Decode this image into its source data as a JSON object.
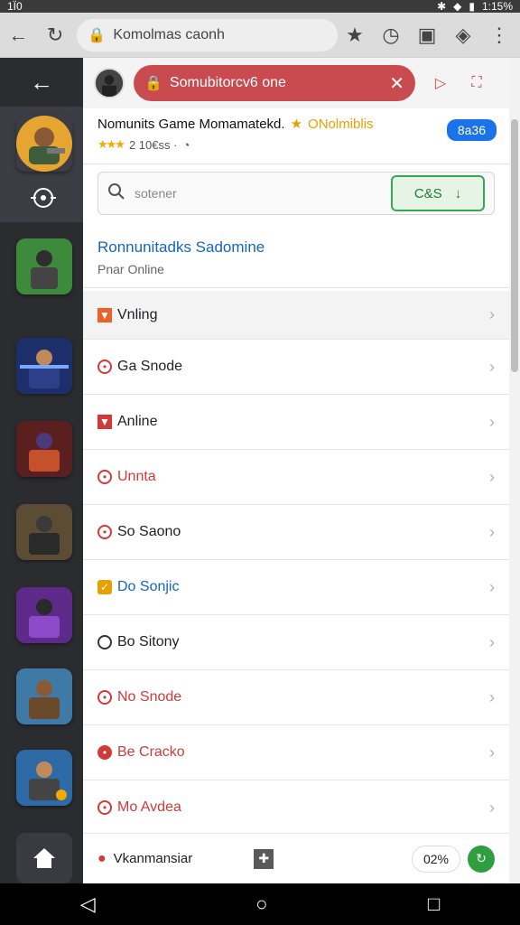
{
  "status": {
    "left": "1Ï0",
    "right": "1:15%"
  },
  "browser": {
    "url_text": "Komolmas caonh"
  },
  "tab": {
    "title": "Somubitorcv6 one"
  },
  "app": {
    "title": "Nomunits Game Momamatekd.",
    "developer": "ONolmiblis",
    "rating_text": "2 10€ss ·",
    "badge": "8a36"
  },
  "search": {
    "placeholder": "sotener",
    "get_label": "C&S"
  },
  "page": {
    "title": "Ronnunitadks Sadomine",
    "subtitle": "Pnar Online"
  },
  "list": [
    {
      "label": "Vnling",
      "icon": "flag-icon",
      "color": "#e8622a"
    },
    {
      "label": "Ga Snode",
      "icon": "ring-icon",
      "color": "#d23a3a"
    },
    {
      "label": "Anline",
      "icon": "flag-icon",
      "color": "#d23a3a"
    },
    {
      "label": "Unnta",
      "icon": "ring-icon",
      "color": "#d23a3a"
    },
    {
      "label": "So Saono",
      "icon": "ring-icon",
      "color": "#d23a3a"
    },
    {
      "label": "Do Sonjic",
      "icon": "check-icon",
      "color": "#e6a100"
    },
    {
      "label": "Bo Sitony",
      "icon": "circle-icon",
      "color": "#333333"
    },
    {
      "label": "No Snode",
      "icon": "ring-icon",
      "color": "#d23a3a"
    },
    {
      "label": "Be Cracko",
      "icon": "ring-icon",
      "color": "#d23a3a"
    },
    {
      "label": "Mo Avdea",
      "icon": "ring-icon",
      "color": "#d23a3a"
    }
  ],
  "bottom": {
    "label": "Vkanmansiar",
    "percent": "02%"
  }
}
